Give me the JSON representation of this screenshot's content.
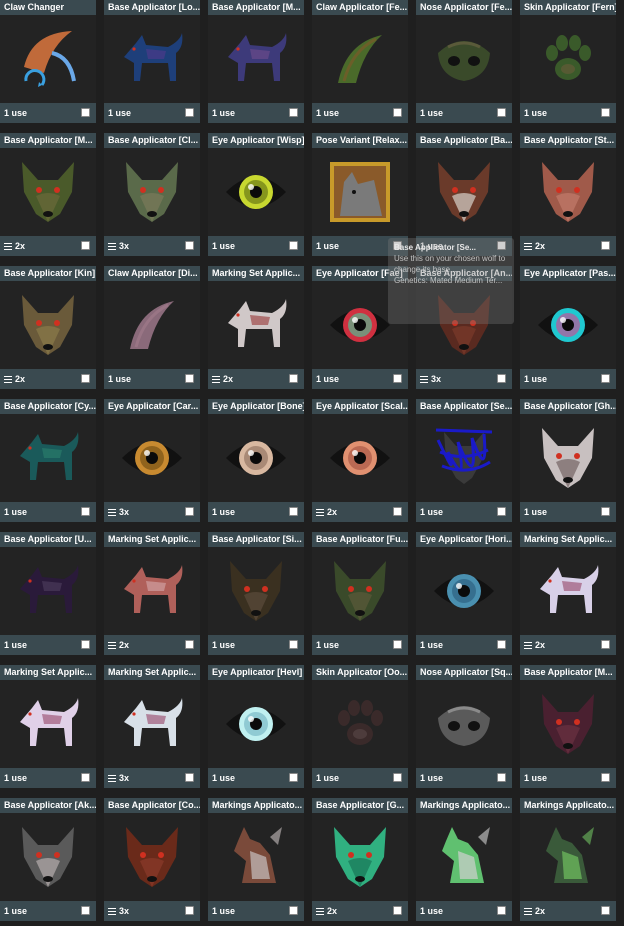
{
  "inventory": {
    "items": [
      {
        "title": "Claw Changer",
        "qty": "1 use",
        "stacked": false,
        "icon": "claw-swap-icon",
        "color": "#c06a3a",
        "accent": "#3aa0e0"
      },
      {
        "title": "Base Applicator [Lo...",
        "qty": "1 use",
        "stacked": false,
        "icon": "wolf-body-icon",
        "color": "#1e3f7a",
        "accent": "#4a3a8a"
      },
      {
        "title": "Base Applicator [M...",
        "qty": "1 use",
        "stacked": false,
        "icon": "wolf-body-icon",
        "color": "#3d3a7a",
        "accent": "#6a4a8a"
      },
      {
        "title": "Claw Applicator [Fe...",
        "qty": "1 use",
        "stacked": false,
        "icon": "claw-icon",
        "color": "#4a6a2a",
        "accent": "#7a5a2a"
      },
      {
        "title": "Nose Applicator [Fe...",
        "qty": "1 use",
        "stacked": false,
        "icon": "nose-icon",
        "color": "#3a4a2a",
        "accent": "#5a5a3a"
      },
      {
        "title": "Skin Applicator [Fern]",
        "qty": "1 use",
        "stacked": false,
        "icon": "paw-icon",
        "color": "#3a5a2a",
        "accent": "#6a5a3a"
      },
      {
        "title": "Base Applicator [M...",
        "qty": "2x",
        "stacked": true,
        "icon": "wolf-head-icon",
        "color": "#4a5a2a",
        "accent": "#6a6a3a"
      },
      {
        "title": "Base Applicator [Cl...",
        "qty": "3x",
        "stacked": true,
        "icon": "wolf-head-icon",
        "color": "#5a6a4a",
        "accent": "#7a7a5a"
      },
      {
        "title": "Eye Applicator [Wisp]",
        "qty": "1 use",
        "stacked": false,
        "icon": "eye-icon",
        "color": "#c8d830",
        "accent": "#5a6a10"
      },
      {
        "title": "Pose Variant [Relax...",
        "qty": "1 use",
        "stacked": false,
        "icon": "framed-wolf-icon",
        "color": "#7a7a7a",
        "accent": "#c89a2a"
      },
      {
        "title": "Base Applicator [Ba...",
        "qty": "1 use",
        "stacked": false,
        "icon": "wolf-head-icon",
        "color": "#6a3a2a",
        "accent": "#d0c8c0"
      },
      {
        "title": "Base Applicator [St...",
        "qty": "2x",
        "stacked": true,
        "icon": "wolf-head-icon",
        "color": "#a05a4a",
        "accent": "#c07a6a"
      },
      {
        "title": "Base Applicator [Kin]",
        "qty": "2x",
        "stacked": true,
        "icon": "wolf-head-icon",
        "color": "#6a5a3a",
        "accent": "#8a7a4a"
      },
      {
        "title": "Claw Applicator [Di...",
        "qty": "1 use",
        "stacked": false,
        "icon": "claw-icon",
        "color": "#8a6a7a",
        "accent": "#a07a8a"
      },
      {
        "title": "Marking Set Applic...",
        "qty": "2x",
        "stacked": true,
        "icon": "wolf-body-icon",
        "color": "#d0c8c8",
        "accent": "#a04a4a"
      },
      {
        "title": "Eye Applicator [Fae]",
        "qty": "1 use",
        "stacked": false,
        "icon": "eye-icon",
        "color": "#d03040",
        "accent": "#40d0a0"
      },
      {
        "title": "Base Applicator [An...",
        "qty": "3x",
        "stacked": true,
        "icon": "wolf-head-icon",
        "color": "#5a2a20",
        "accent": "#7a3a2a"
      },
      {
        "title": "Eye Applicator [Pas...",
        "qty": "1 use",
        "stacked": false,
        "icon": "eye-icon",
        "color": "#20c8d0",
        "accent": "#e04090"
      },
      {
        "title": "Base Applicator [Cy...",
        "qty": "1 use",
        "stacked": false,
        "icon": "wolf-body-icon",
        "color": "#1a5a5a",
        "accent": "#2a7a6a"
      },
      {
        "title": "Eye Applicator [Car...",
        "qty": "3x",
        "stacked": true,
        "icon": "eye-icon",
        "color": "#c88a30",
        "accent": "#6a4a10"
      },
      {
        "title": "Eye Applicator [Bone]",
        "qty": "1 use",
        "stacked": false,
        "icon": "eye-icon",
        "color": "#d8b8a0",
        "accent": "#8a6a5a"
      },
      {
        "title": "Eye Applicator [Scal...",
        "qty": "2x",
        "stacked": true,
        "icon": "eye-icon",
        "color": "#e09070",
        "accent": "#a05040"
      },
      {
        "title": "Base Applicator [Se...",
        "qty": "1 use",
        "stacked": false,
        "icon": "scribbled-wolf-icon",
        "color": "#1a1ac8",
        "accent": "#3a3a3a"
      },
      {
        "title": "Base Applicator [Gh...",
        "qty": "1 use",
        "stacked": false,
        "icon": "wolf-head-icon",
        "color": "#c8c0c0",
        "accent": "#7a6a6a"
      },
      {
        "title": "Base Applicator [U...",
        "qty": "1 use",
        "stacked": false,
        "icon": "wolf-body-icon",
        "color": "#2a1a3a",
        "accent": "#4a3a5a"
      },
      {
        "title": "Marking Set Applic...",
        "qty": "2x",
        "stacked": true,
        "icon": "wolf-body-icon",
        "color": "#b0605a",
        "accent": "#d0a0a0"
      },
      {
        "title": "Base Applicator [Si...",
        "qty": "1 use",
        "stacked": false,
        "icon": "wolf-head-icon",
        "color": "#3a3020",
        "accent": "#5a4a3a"
      },
      {
        "title": "Base Applicator [Fu...",
        "qty": "1 use",
        "stacked": false,
        "icon": "wolf-head-icon",
        "color": "#3a4a2a",
        "accent": "#5a5a3a"
      },
      {
        "title": "Eye Applicator [Hori...",
        "qty": "1 use",
        "stacked": false,
        "icon": "eye-icon",
        "color": "#4a90b0",
        "accent": "#2a5a7a"
      },
      {
        "title": "Marking Set Applic...",
        "qty": "2x",
        "stacked": true,
        "icon": "wolf-body-icon",
        "color": "#d8d0e8",
        "accent": "#a05a7a"
      },
      {
        "title": "Marking Set Applic...",
        "qty": "1 use",
        "stacked": false,
        "icon": "wolf-body-icon",
        "color": "#e0d0e8",
        "accent": "#a05a7a"
      },
      {
        "title": "Marking Set Applic...",
        "qty": "3x",
        "stacked": true,
        "icon": "wolf-body-icon",
        "color": "#d8e0e8",
        "accent": "#a05a7a"
      },
      {
        "title": "Eye Applicator [Hevl]",
        "qty": "1 use",
        "stacked": false,
        "icon": "eye-icon",
        "color": "#c0f0f0",
        "accent": "#70b0c0"
      },
      {
        "title": "Skin Applicator [Oo...",
        "qty": "1 use",
        "stacked": false,
        "icon": "paw-icon",
        "color": "#3a2a2a",
        "accent": "#5a4a4a"
      },
      {
        "title": "Nose Applicator [Sq...",
        "qty": "1 use",
        "stacked": false,
        "icon": "nose-icon",
        "color": "#5a5a5a",
        "accent": "#8a8a8a"
      },
      {
        "title": "Base Applicator [M...",
        "qty": "1 use",
        "stacked": false,
        "icon": "wolf-head-icon",
        "color": "#4a2030",
        "accent": "#6a3040"
      },
      {
        "title": "Base Applicator [Ak...",
        "qty": "1 use",
        "stacked": false,
        "icon": "wolf-head-icon",
        "color": "#5a5a5a",
        "accent": "#b0a8a8"
      },
      {
        "title": "Base Applicator [Co...",
        "qty": "3x",
        "stacked": true,
        "icon": "wolf-head-icon",
        "color": "#6a2a1a",
        "accent": "#8a3a2a"
      },
      {
        "title": "Markings Applicato...",
        "qty": "1 use",
        "stacked": false,
        "icon": "wolf-sitting-icon",
        "color": "#7a4a3a",
        "accent": "#c8c0c0"
      },
      {
        "title": "Base Applicator [G...",
        "qty": "2x",
        "stacked": true,
        "icon": "wolf-head-icon",
        "color": "#30b080",
        "accent": "#1a7a5a"
      },
      {
        "title": "Markings Applicato...",
        "qty": "1 use",
        "stacked": false,
        "icon": "wolf-sitting-icon",
        "color": "#60c070",
        "accent": "#d0d0d0"
      },
      {
        "title": "Markings Applicato...",
        "qty": "2x",
        "stacked": true,
        "icon": "wolf-sitting-icon",
        "color": "#3a5a3a",
        "accent": "#70c060"
      }
    ]
  },
  "tooltip": {
    "title": "Base Applicator [Se...",
    "line1": "Use this on your chosen wolf to",
    "line2": "change its base ...",
    "line3": "Genetics: Mated Medium Ter..."
  }
}
